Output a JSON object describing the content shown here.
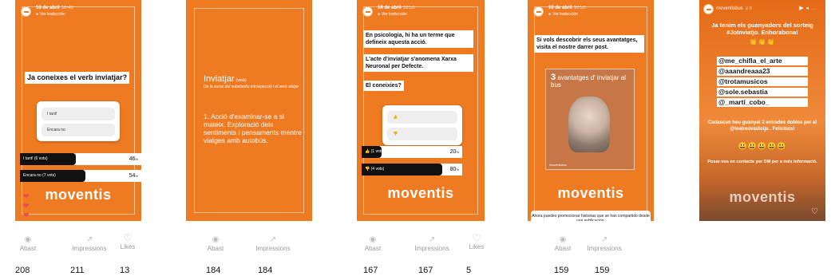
{
  "story1": {
    "date": "18 de abril",
    "time": "10:46",
    "translate": "Ver traducción",
    "question": "Ja coneixes el verb inviatjar?",
    "options": [
      "I tant!",
      "Encara no"
    ],
    "results": [
      {
        "label": "I tant! (6 vots)",
        "pct": "46",
        "fraction": 0.46
      },
      {
        "label": "Encara no (7 vots)",
        "pct": "54",
        "fraction": 0.54
      }
    ],
    "logo": "moventis"
  },
  "story2": {
    "word": "Inviatjar",
    "word_type": "(verb)",
    "subtitle": "De la suma del substantiu introspecció i el verb viatjar",
    "definition": "1. Acció d'examinar-se a si mateix. Exploració dels sentiments i pensaments mentre viatges amb autobús."
  },
  "story3": {
    "date": "18 de abril",
    "time": "10:50",
    "translate": "Ver traducción",
    "text1": "En psicologia, hi ha un terme que defineix aquesta acció.",
    "text2": "L'acte d'inviatjar s'anomena Xarxa Neuronal per Defecte.",
    "question": "El coneixies?",
    "options": [
      "👍",
      "👎"
    ],
    "results": [
      {
        "label": "👍 (1 vots)",
        "pct": "20",
        "fraction": 0.2
      },
      {
        "label": "👎 (4 vots)",
        "pct": "80",
        "fraction": 0.8
      }
    ],
    "logo": "moventis"
  },
  "story4": {
    "date": "18 de abril",
    "time": "10:52",
    "translate": "Ver traducción",
    "text": "Si vols descobrir els seus avantatges, visita el nostre darrer post.",
    "promo_number": "3",
    "promo_title": "avantatges d' inviatjar al bus",
    "promo_footer": "#moventisbus",
    "logo": "moventis",
    "tip": "Ahora puedes promocionar historias que se han compartido desde una publicación."
  },
  "story5": {
    "username": "moventisbus",
    "age": "2 h",
    "headline": "Ja tenim els guanyadors del sorteig #JoInviatjo. Enhorabona!",
    "mentions": [
      "@me_chifla_el_arte",
      "@aaandreaaa23",
      "@trotamusicos",
      "@sole.sebastia",
      "@_marti_cobo_"
    ],
    "prize": "Cadascun heu guanyat 2 entrades dobles per al @teatredelallotja . Felicitats!",
    "contact": "Posar-vos en contacte per DM per a més informació.",
    "emojis": "😃😃😃😃😃",
    "logo": "moventis"
  },
  "stats_labels": {
    "reach": "Abast",
    "impressions": "Impressions",
    "likes": "Likes"
  },
  "stats": [
    {
      "reach": "208",
      "impressions": "211",
      "likes": "13"
    },
    {
      "reach": "184",
      "impressions": "184"
    },
    {
      "reach": "167",
      "impressions": "167",
      "likes": "5"
    },
    {
      "reach": "159",
      "impressions": "159"
    }
  ],
  "colors": {
    "brand_orange": "#ee7a22",
    "heart": "#f0465e"
  }
}
